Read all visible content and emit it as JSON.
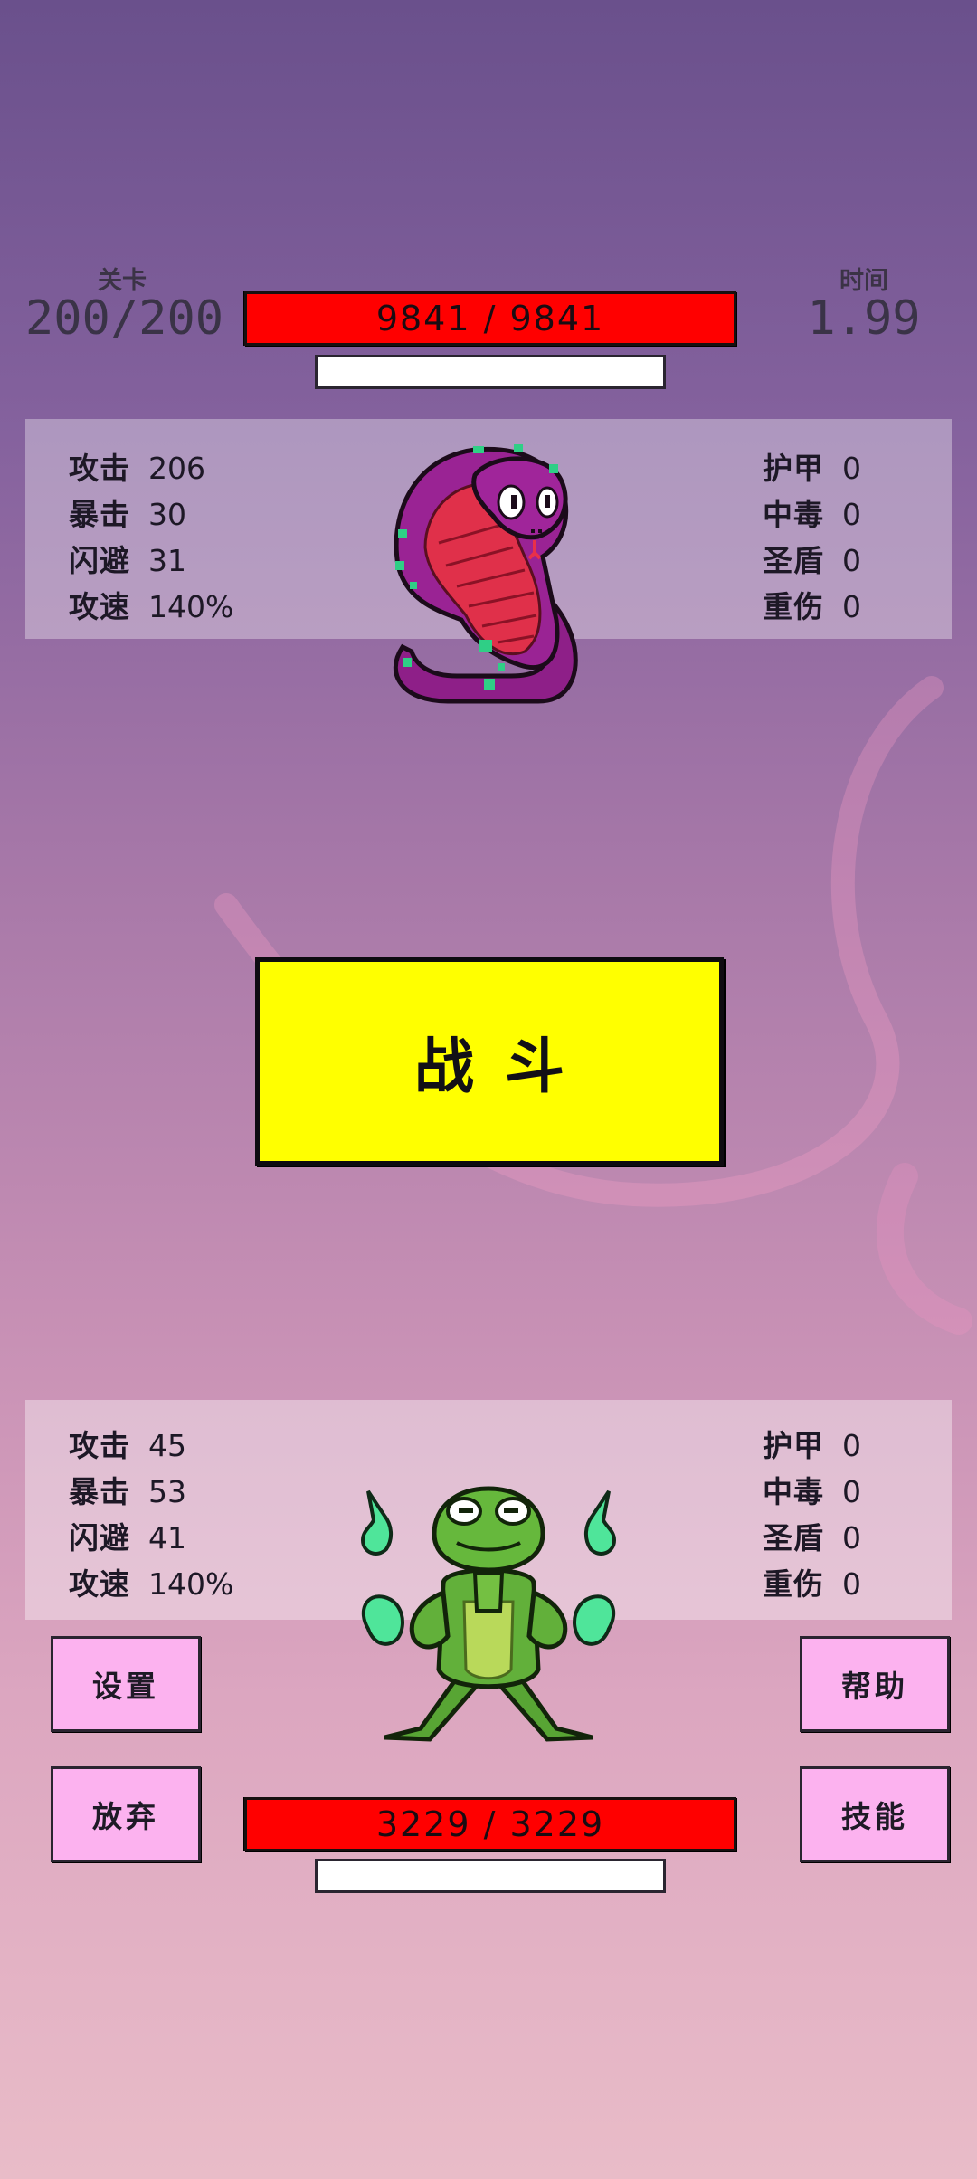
{
  "header": {
    "level_label": "关卡",
    "level_value": "200/200",
    "time_label": "时间",
    "time_value": "1.99"
  },
  "enemy": {
    "name_icon": "cobra-sprite",
    "hp_text": "9841 / 9841",
    "hp_current": 9841,
    "hp_max": 9841,
    "stats_left": [
      {
        "label": "攻击",
        "value": "206"
      },
      {
        "label": "暴击",
        "value": "30"
      },
      {
        "label": "闪避",
        "value": "31"
      },
      {
        "label": "攻速",
        "value": "140%"
      }
    ],
    "stats_right": [
      {
        "label": "护甲",
        "value": "0"
      },
      {
        "label": "中毒",
        "value": "0"
      },
      {
        "label": "圣盾",
        "value": "0"
      },
      {
        "label": "重伤",
        "value": "0"
      }
    ]
  },
  "fight_button": "战斗",
  "player": {
    "name_icon": "frog-sprite",
    "hp_text": "3229 / 3229",
    "hp_current": 3229,
    "hp_max": 3229,
    "stats_left": [
      {
        "label": "攻击",
        "value": "45"
      },
      {
        "label": "暴击",
        "value": "53"
      },
      {
        "label": "闪避",
        "value": "41"
      },
      {
        "label": "攻速",
        "value": "140%"
      }
    ],
    "stats_right": [
      {
        "label": "护甲",
        "value": "0"
      },
      {
        "label": "中毒",
        "value": "0"
      },
      {
        "label": "圣盾",
        "value": "0"
      },
      {
        "label": "重伤",
        "value": "0"
      }
    ]
  },
  "buttons": {
    "settings": "设置",
    "give_up": "放弃",
    "help": "帮助",
    "skills": "技能"
  },
  "colors": {
    "hp_bar": "#ff0000",
    "fight_button": "#ffff00",
    "side_button": "#fcb2ef"
  }
}
